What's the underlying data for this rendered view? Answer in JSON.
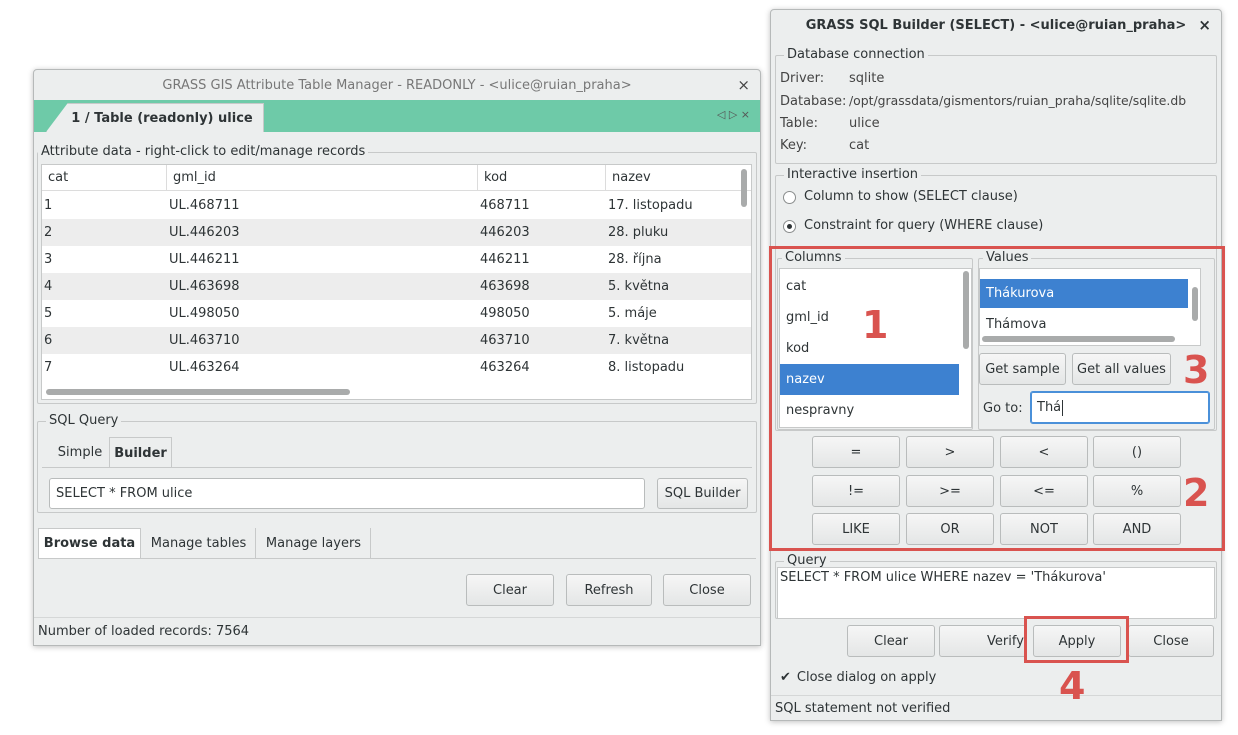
{
  "atm": {
    "title": "GRASS GIS Attribute Table Manager - READONLY - <ulice@ruian_praha>",
    "close_glyph": "×",
    "tab_label": "1 / Table (readonly) ulice",
    "tab_controls": "◁ ▷ ×",
    "attr_group_label": "Attribute data - right-click to edit/manage records",
    "table": {
      "headers": [
        "cat",
        "gml_id",
        "kod",
        "nazev"
      ],
      "rows": [
        [
          "1",
          "UL.468711",
          "468711",
          "17. listopadu"
        ],
        [
          "2",
          "UL.446203",
          "446203",
          "28. pluku"
        ],
        [
          "3",
          "UL.446211",
          "446211",
          "28. října"
        ],
        [
          "4",
          "UL.463698",
          "463698",
          "5. května"
        ],
        [
          "5",
          "UL.498050",
          "498050",
          "5. máje"
        ],
        [
          "6",
          "UL.463710",
          "463710",
          "7. května"
        ],
        [
          "7",
          "UL.463264",
          "463264",
          "8. listopadu"
        ]
      ]
    },
    "sql_group_label": "SQL Query",
    "sql_tabs": [
      "Simple",
      "Builder"
    ],
    "sql_value": "SELECT * FROM ulice",
    "sql_builder_btn": "SQL Builder",
    "bottom_tabs": [
      "Browse data",
      "Manage tables",
      "Manage layers"
    ],
    "clear_btn": "Clear",
    "refresh_btn": "Refresh",
    "close_btn": "Close",
    "status": "Number of loaded records: 7564"
  },
  "sqlb": {
    "title": "GRASS SQL Builder (SELECT) - <ulice@ruian_praha>",
    "close_glyph": "×",
    "db_group_label": "Database connection",
    "driver_label": "Driver:",
    "driver_value": "sqlite",
    "database_label": "Database:",
    "database_value": "/opt/grassdata/gismentors/ruian_praha/sqlite/sqlite.db",
    "table_label": "Table:",
    "table_value": "ulice",
    "key_label": "Key:",
    "key_value": "cat",
    "ins_group_label": "Interactive insertion",
    "radio_select": "Column to show (SELECT clause)",
    "radio_where": "Constraint for query (WHERE clause)",
    "columns_label": "Columns",
    "columns": [
      "cat",
      "gml_id",
      "kod",
      "nazev",
      "nespravny"
    ],
    "values_label": "Values",
    "values": [
      "Thákurova",
      "Thámova"
    ],
    "get_sample_btn": "Get sample",
    "get_all_btn": "Get all values",
    "goto_label": "Go to:",
    "goto_value": "Thá",
    "ops": [
      "=",
      ">",
      "<",
      "()",
      "!=",
      ">=",
      "<=",
      "%",
      "LIKE",
      "OR",
      "NOT",
      "AND"
    ],
    "query_group_label": "Query",
    "query_value": "SELECT * FROM ulice WHERE nazev =  'Thákurova'",
    "clear_btn": "Clear",
    "verify_btn": "Verify",
    "apply_btn": "Apply",
    "close_btn": "Close",
    "close_on_apply": "Close dialog on apply",
    "status": "SQL statement not verified"
  },
  "annotations": [
    "1",
    "2",
    "3",
    "4"
  ],
  "colors": {
    "annotation": "#d9534f",
    "selection": "#3d81d0",
    "tab_accent": "#6ecaa8"
  }
}
